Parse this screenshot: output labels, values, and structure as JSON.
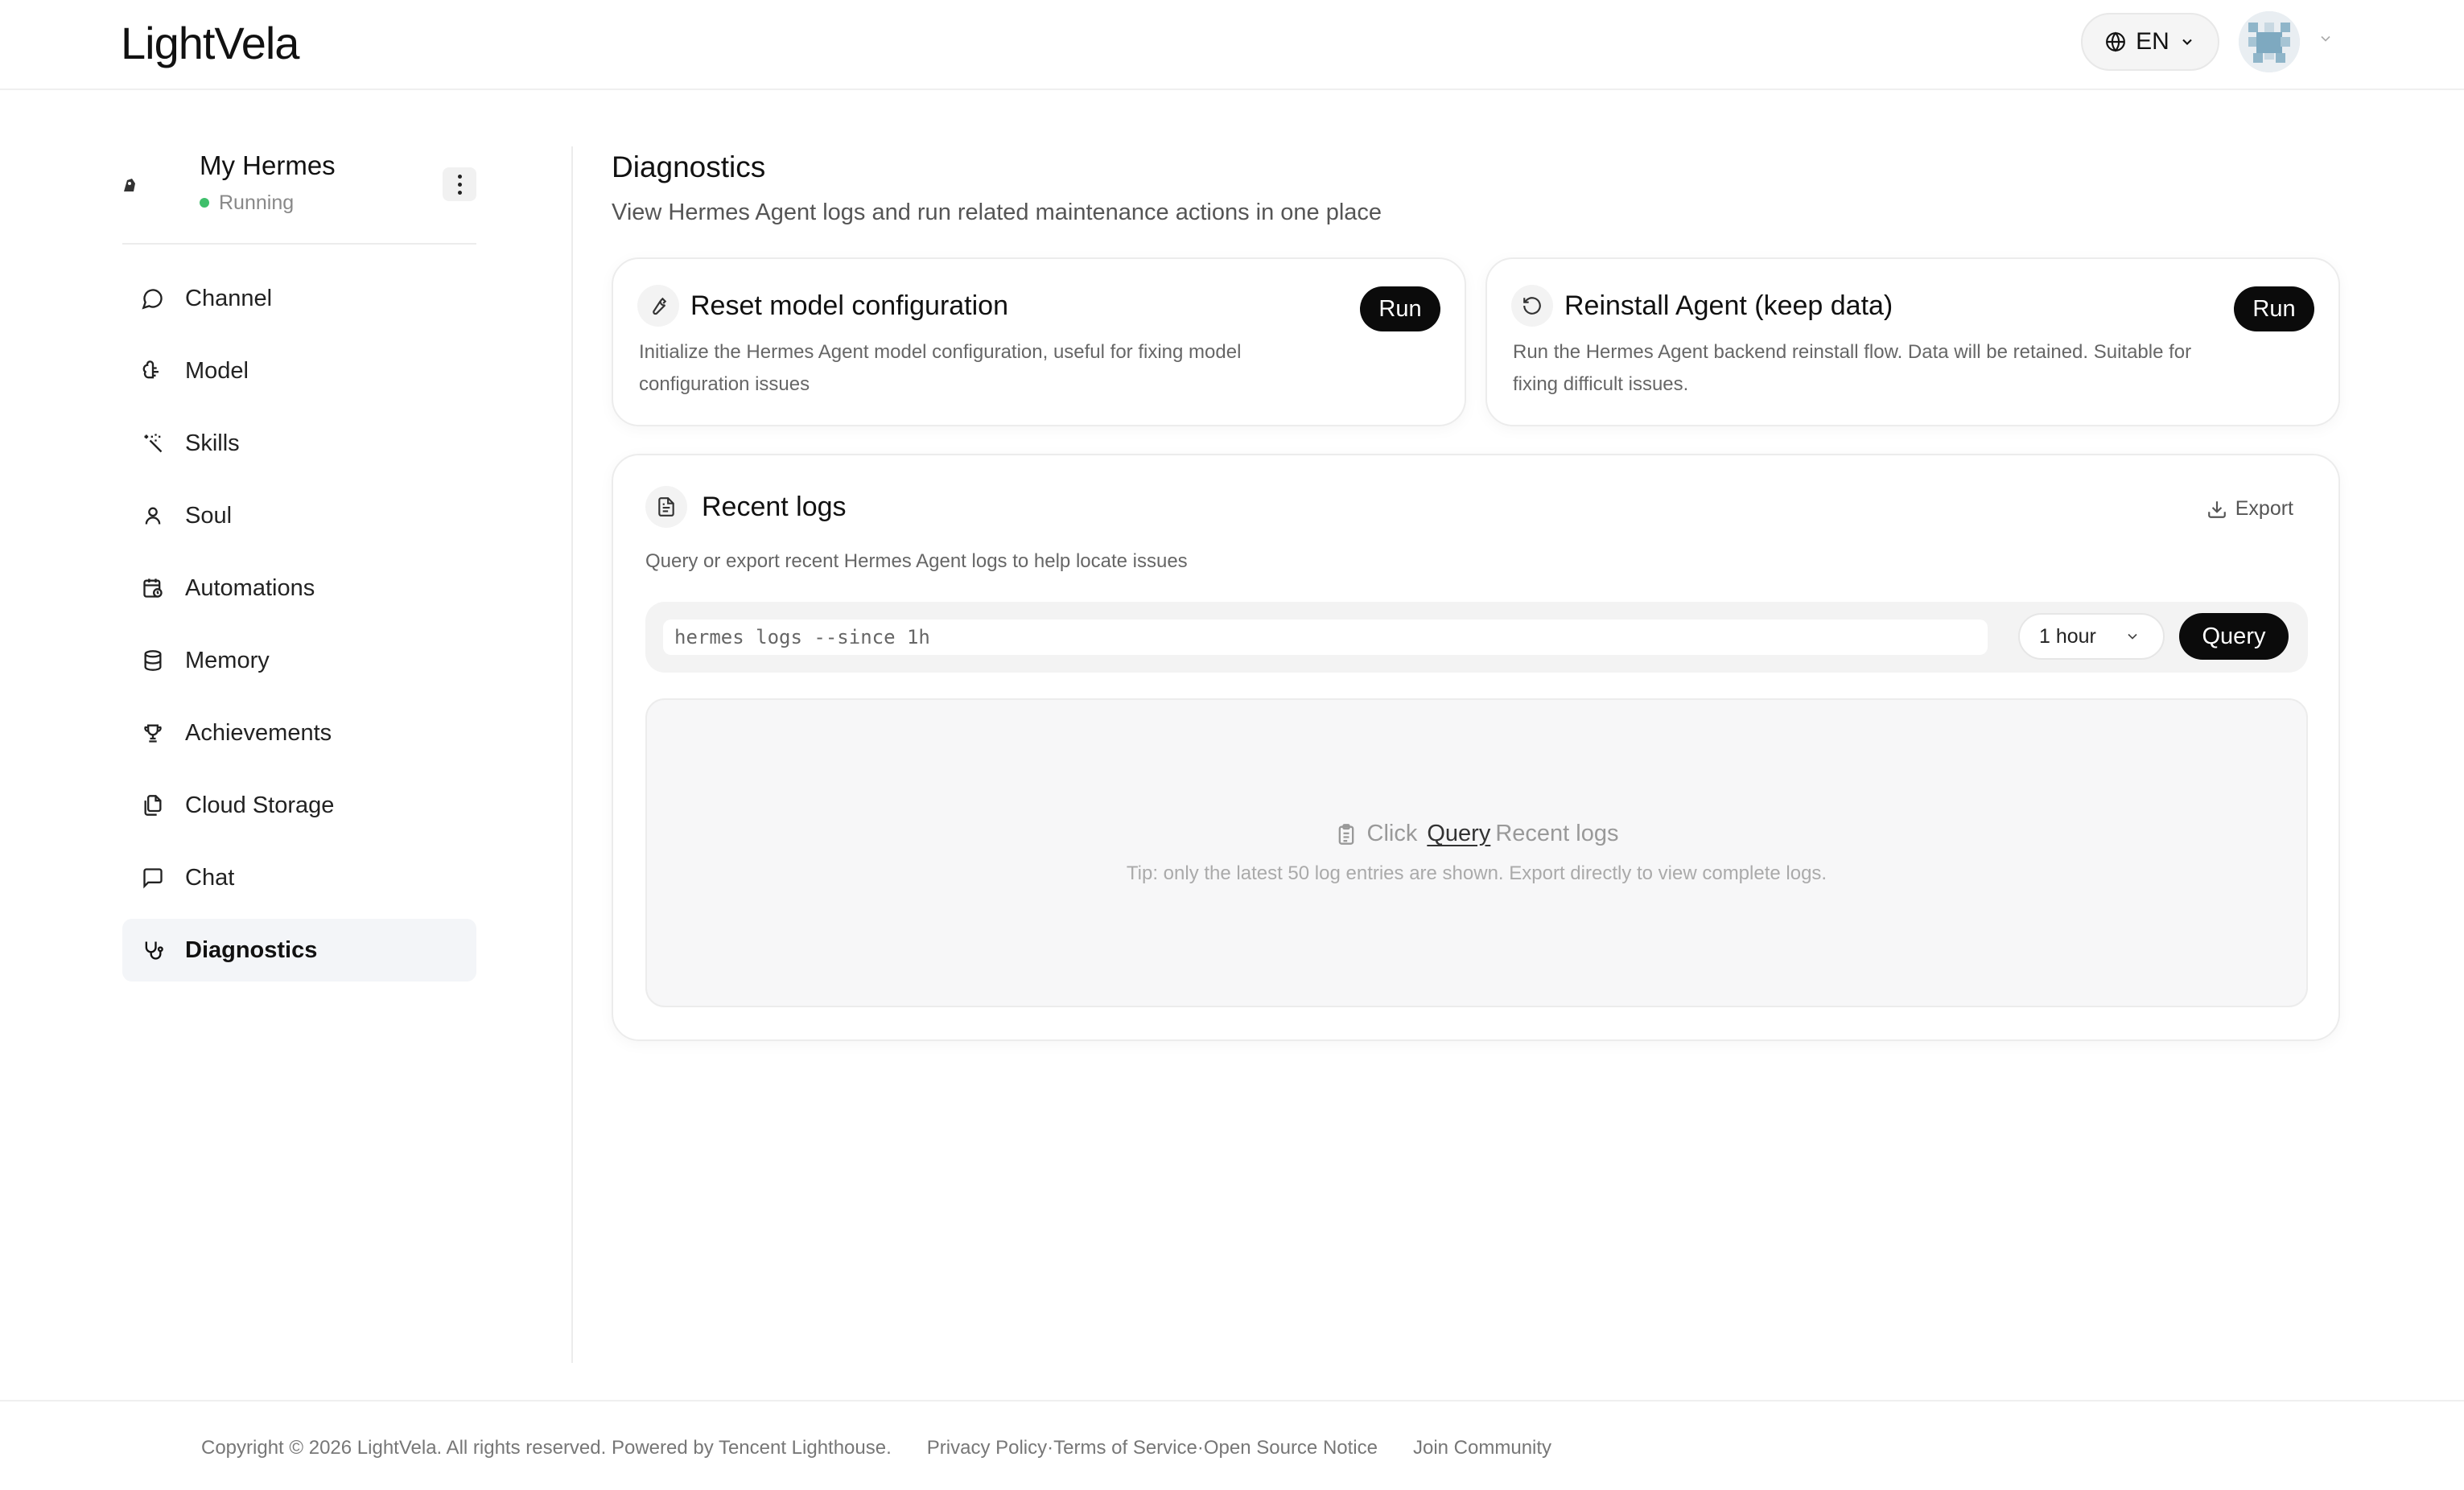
{
  "header": {
    "logo": "LightVela",
    "language": "EN"
  },
  "agent": {
    "logo_text": "HERMES AGENT",
    "name": "My Hermes",
    "status": "Running",
    "status_color": "#3fbf6b"
  },
  "sidebar": {
    "items": [
      {
        "label": "Channel",
        "icon": "chat-bubble-icon"
      },
      {
        "label": "Model",
        "icon": "brain-icon"
      },
      {
        "label": "Skills",
        "icon": "magic-wand-icon"
      },
      {
        "label": "Soul",
        "icon": "person-icon"
      },
      {
        "label": "Automations",
        "icon": "calendar-clock-icon"
      },
      {
        "label": "Memory",
        "icon": "database-icon"
      },
      {
        "label": "Achievements",
        "icon": "trophy-icon"
      },
      {
        "label": "Cloud Storage",
        "icon": "files-icon"
      },
      {
        "label": "Chat",
        "icon": "message-square-icon"
      },
      {
        "label": "Diagnostics",
        "icon": "stethoscope-icon",
        "active": true
      }
    ]
  },
  "main": {
    "title": "Diagnostics",
    "subtitle": "View Hermes Agent logs and run related maintenance actions in one place",
    "actions": [
      {
        "title": "Reset model configuration",
        "description": "Initialize the Hermes Agent model configuration, useful for fixing model configuration issues",
        "button": "Run",
        "icon": "wrench-icon"
      },
      {
        "title": "Reinstall Agent (keep data)",
        "description": "Run the Hermes Agent backend reinstall flow. Data will be retained. Suitable for fixing difficult issues.",
        "button": "Run",
        "icon": "rotate-ccw-icon"
      }
    ],
    "logs": {
      "title": "Recent logs",
      "subtitle": "Query or export recent Hermes Agent logs to help locate issues",
      "export_label": "Export",
      "command_value": "hermes logs --since 1h",
      "time_range": "1 hour",
      "query_button": "Query",
      "empty_prefix": "Click",
      "empty_link": "Query",
      "empty_suffix": "Recent logs",
      "tip": "Tip: only the latest 50 log entries are shown. Export directly to view complete logs."
    }
  },
  "footer": {
    "copyright": "Copyright © 2026 LightVela. All rights reserved. Powered by Tencent Lighthouse.",
    "privacy": "Privacy Policy",
    "terms": "Terms of Service",
    "open_source": "Open Source Notice",
    "separator": "·",
    "community": "Join Community"
  }
}
